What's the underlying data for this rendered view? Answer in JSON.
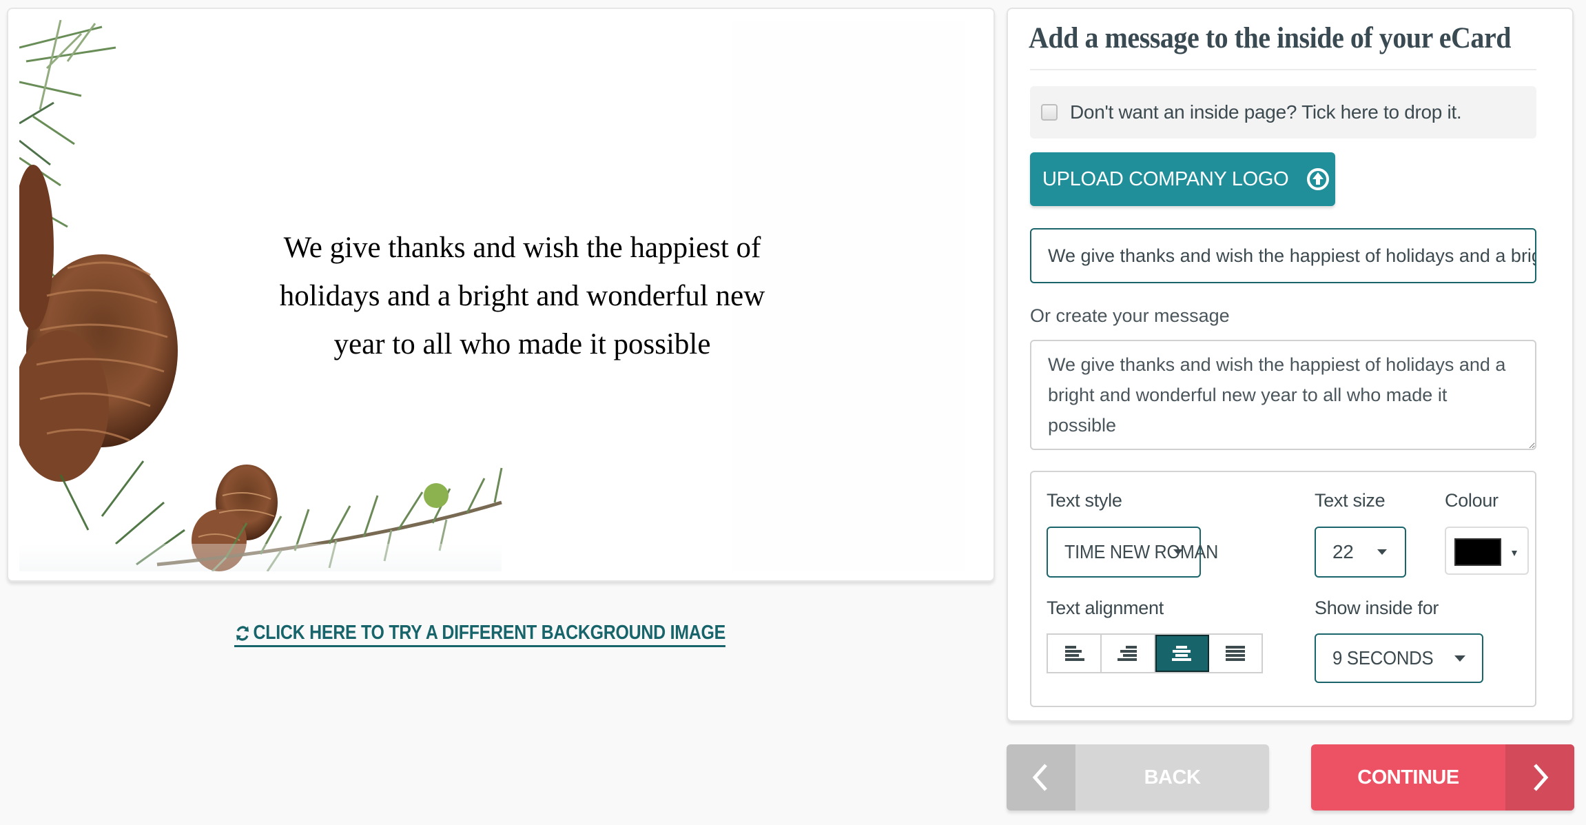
{
  "preview": {
    "card_message": "We give thanks and wish the happiest of holidays and a bright and wonderful new year to all who made it possible",
    "background_image": "pine-cones-and-branches",
    "change_background_link": "CLICK HERE TO TRY A DIFFERENT BACKGROUND IMAGE",
    "link_icon": "refresh-icon",
    "message_color": "#000000"
  },
  "panel": {
    "title": "Add a message to the inside of your eCard",
    "drop_inside_page": {
      "label": "Don't want an inside page? Tick here to drop it.",
      "checked": false
    },
    "upload_logo": {
      "label": "UPLOAD COMPANY LOGO",
      "icon": "upload-circle-icon"
    },
    "preset_message_value": "We give thanks and wish the happiest of holidays and a bright and wonderful new year to all who made it possible",
    "custom_message": {
      "label": "Or create your message",
      "value": "We give thanks and wish the happiest of holidays and a bright and wonderful new year to all who made it possible"
    },
    "options": {
      "text_style": {
        "label": "Text style",
        "value": "TIME NEW ROMAN"
      },
      "text_size": {
        "label": "Text size",
        "value": "22"
      },
      "colour": {
        "label": "Colour",
        "value": "#000000"
      },
      "text_alignment": {
        "label": "Text alignment",
        "buttons": [
          {
            "name": "align-left",
            "active": false
          },
          {
            "name": "align-right",
            "active": false
          },
          {
            "name": "align-center",
            "active": true
          },
          {
            "name": "align-justify",
            "active": false
          }
        ]
      },
      "show_inside_for": {
        "label": "Show inside for",
        "value": "9 SECONDS"
      }
    }
  },
  "footer": {
    "back_label": "BACK",
    "continue_label": "CONTINUE"
  },
  "colors": {
    "teal_primary": "#208f9a",
    "teal_dark": "#17646b",
    "continue_red": "#ec5263",
    "back_grey": "#d6d6d6"
  }
}
